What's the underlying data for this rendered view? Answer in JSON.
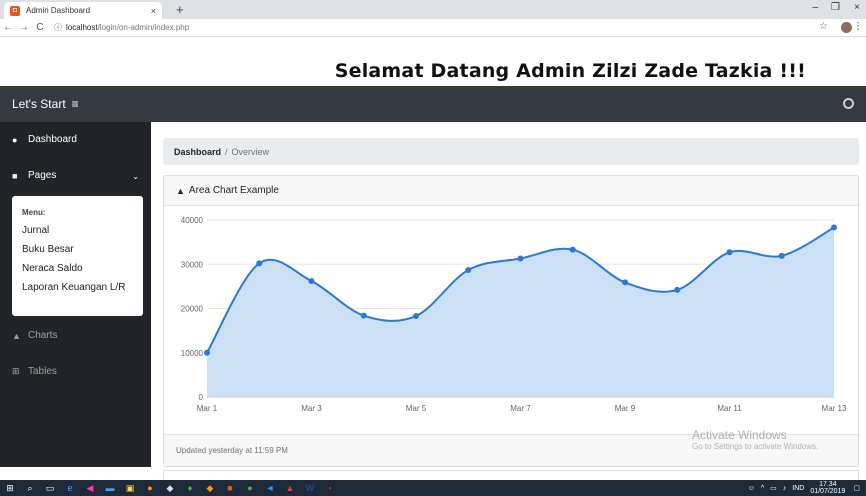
{
  "browser": {
    "tab_title": "Admin Dashboard",
    "tab_close": "×",
    "new_tab": "+",
    "url_host": "localhost",
    "url_path": "/login/on-admin/index.php",
    "minimize": "–",
    "restore": "❐",
    "close": "×"
  },
  "welcome": "Selamat Datang Admin Zilzi Zade Tazkia !!!",
  "navbar": {
    "brand": "Let's Start",
    "menu_toggle": "≡"
  },
  "sidebar": {
    "items": [
      {
        "label": "Dashboard",
        "icon": "tachometer-icon"
      },
      {
        "label": "Pages",
        "icon": "folder-icon"
      },
      {
        "label": "Charts",
        "icon": "area-chart-icon"
      },
      {
        "label": "Tables",
        "icon": "table-icon"
      }
    ],
    "dropdown_header": "Menu:",
    "dropdown_links": [
      "Jurnal",
      "Buku Besar",
      "Neraca Saldo",
      "Laporan Keuangan L/R"
    ]
  },
  "breadcrumb": {
    "active": "Dashboard",
    "separator": "/",
    "current": "Overview"
  },
  "card": {
    "title": "Area Chart Example",
    "footer": "Updated yesterday at 11:59 PM"
  },
  "watermark": {
    "line1": "Activate Windows",
    "line2": "Go to Settings to activate Windows."
  },
  "taskbar": {
    "lang": "IND",
    "time": "17.34",
    "date": "01/07/2019"
  },
  "colors": {
    "navbar": "#343a40",
    "sidebar": "#212529",
    "line": "#2a7ad5",
    "fill": "#cce0f5"
  },
  "chart_data": {
    "type": "area",
    "x": [
      "Mar 1",
      "Mar 2",
      "Mar 3",
      "Mar 4",
      "Mar 5",
      "Mar 6",
      "Mar 7",
      "Mar 8",
      "Mar 9",
      "Mar 10",
      "Mar 11",
      "Mar 12",
      "Mar 13"
    ],
    "x_tick_labels": [
      "Mar 1",
      "Mar 3",
      "Mar 5",
      "Mar 7",
      "Mar 9",
      "Mar 11",
      "Mar 13"
    ],
    "values": [
      10000,
      30200,
      26200,
      18400,
      18300,
      28700,
      31300,
      33300,
      25900,
      24200,
      32700,
      31900,
      38300
    ],
    "ylim": [
      0,
      40000
    ],
    "y_ticks": [
      0,
      10000,
      20000,
      30000,
      40000
    ],
    "grid": true
  }
}
